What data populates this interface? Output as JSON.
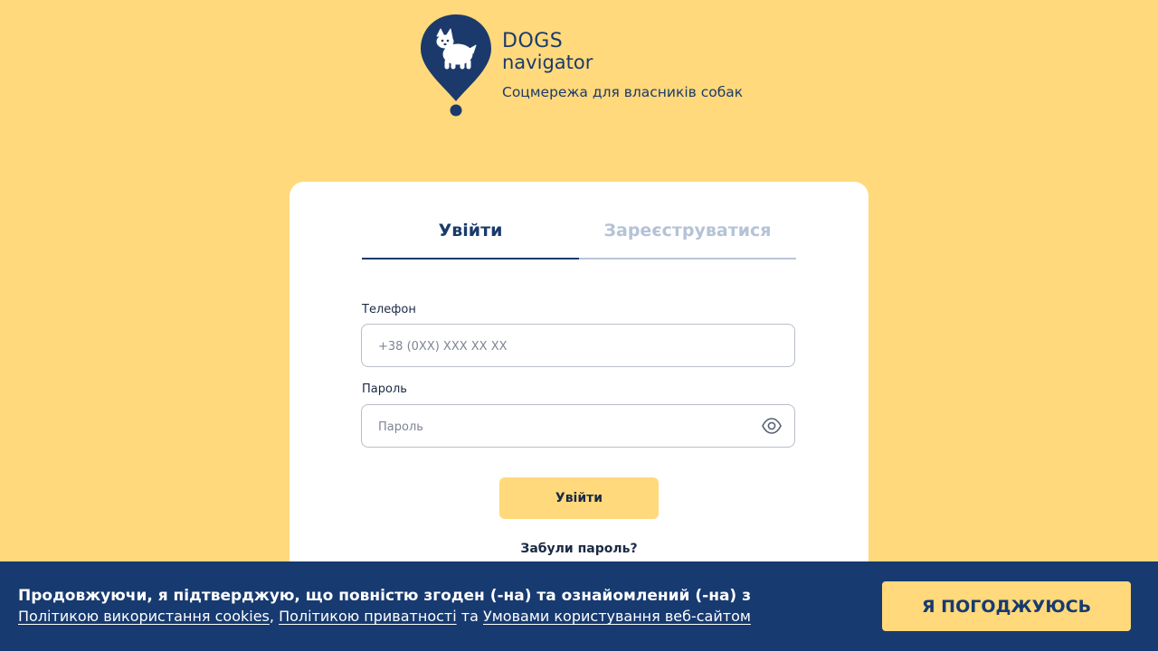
{
  "brand": {
    "name_line1": "DOGS",
    "name_line2": "navigator",
    "tagline": "Соцмережа для власників собак",
    "logo_icon": "corgi-map-pin-icon"
  },
  "auth": {
    "tabs": [
      {
        "label": "Увійти",
        "active": true
      },
      {
        "label": "Зареєструватися",
        "active": false
      }
    ],
    "phone_label": "Телефон",
    "phone_placeholder": "+38 (0XX) XXX XX XX",
    "password_label": "Пароль",
    "password_placeholder": "Пароль",
    "password_toggle_icon": "eye-icon",
    "submit_label": "Увійти",
    "forgot_label": "Забули пароль?"
  },
  "cookie": {
    "line1": "Продовжуючи, я підтверджую, що повністю згоден (-на) та ознайомлений (-на) з",
    "link_cookies": "Політикою використання cookies",
    "sep1": ",",
    "link_privacy": "Політикою приватності",
    "sep2": "та",
    "link_terms": "Умовами користування веб-сайтом",
    "agree_label": "Я ПОГОДЖУЮСЬ"
  },
  "colors": {
    "background": "#ffd97b",
    "primary": "#1b3a6b",
    "banner": "#173a70",
    "accent": "#ffd97b"
  }
}
